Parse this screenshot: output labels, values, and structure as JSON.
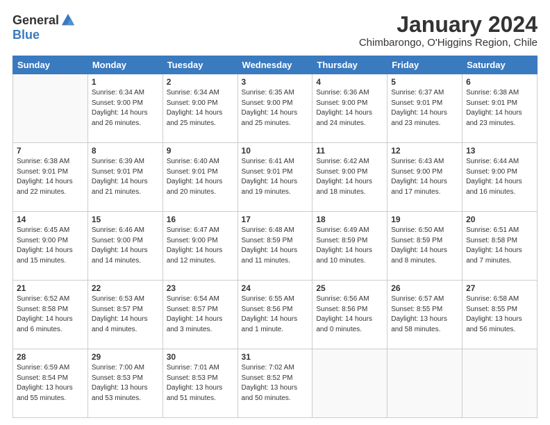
{
  "logo": {
    "general": "General",
    "blue": "Blue"
  },
  "title": "January 2024",
  "subtitle": "Chimbarongo, O'Higgins Region, Chile",
  "days_of_week": [
    "Sunday",
    "Monday",
    "Tuesday",
    "Wednesday",
    "Thursday",
    "Friday",
    "Saturday"
  ],
  "weeks": [
    [
      {
        "day": "",
        "info": ""
      },
      {
        "day": "1",
        "info": "Sunrise: 6:34 AM\nSunset: 9:00 PM\nDaylight: 14 hours\nand 26 minutes."
      },
      {
        "day": "2",
        "info": "Sunrise: 6:34 AM\nSunset: 9:00 PM\nDaylight: 14 hours\nand 25 minutes."
      },
      {
        "day": "3",
        "info": "Sunrise: 6:35 AM\nSunset: 9:00 PM\nDaylight: 14 hours\nand 25 minutes."
      },
      {
        "day": "4",
        "info": "Sunrise: 6:36 AM\nSunset: 9:00 PM\nDaylight: 14 hours\nand 24 minutes."
      },
      {
        "day": "5",
        "info": "Sunrise: 6:37 AM\nSunset: 9:01 PM\nDaylight: 14 hours\nand 23 minutes."
      },
      {
        "day": "6",
        "info": "Sunrise: 6:38 AM\nSunset: 9:01 PM\nDaylight: 14 hours\nand 23 minutes."
      }
    ],
    [
      {
        "day": "7",
        "info": "Sunrise: 6:38 AM\nSunset: 9:01 PM\nDaylight: 14 hours\nand 22 minutes."
      },
      {
        "day": "8",
        "info": "Sunrise: 6:39 AM\nSunset: 9:01 PM\nDaylight: 14 hours\nand 21 minutes."
      },
      {
        "day": "9",
        "info": "Sunrise: 6:40 AM\nSunset: 9:01 PM\nDaylight: 14 hours\nand 20 minutes."
      },
      {
        "day": "10",
        "info": "Sunrise: 6:41 AM\nSunset: 9:01 PM\nDaylight: 14 hours\nand 19 minutes."
      },
      {
        "day": "11",
        "info": "Sunrise: 6:42 AM\nSunset: 9:00 PM\nDaylight: 14 hours\nand 18 minutes."
      },
      {
        "day": "12",
        "info": "Sunrise: 6:43 AM\nSunset: 9:00 PM\nDaylight: 14 hours\nand 17 minutes."
      },
      {
        "day": "13",
        "info": "Sunrise: 6:44 AM\nSunset: 9:00 PM\nDaylight: 14 hours\nand 16 minutes."
      }
    ],
    [
      {
        "day": "14",
        "info": "Sunrise: 6:45 AM\nSunset: 9:00 PM\nDaylight: 14 hours\nand 15 minutes."
      },
      {
        "day": "15",
        "info": "Sunrise: 6:46 AM\nSunset: 9:00 PM\nDaylight: 14 hours\nand 14 minutes."
      },
      {
        "day": "16",
        "info": "Sunrise: 6:47 AM\nSunset: 9:00 PM\nDaylight: 14 hours\nand 12 minutes."
      },
      {
        "day": "17",
        "info": "Sunrise: 6:48 AM\nSunset: 8:59 PM\nDaylight: 14 hours\nand 11 minutes."
      },
      {
        "day": "18",
        "info": "Sunrise: 6:49 AM\nSunset: 8:59 PM\nDaylight: 14 hours\nand 10 minutes."
      },
      {
        "day": "19",
        "info": "Sunrise: 6:50 AM\nSunset: 8:59 PM\nDaylight: 14 hours\nand 8 minutes."
      },
      {
        "day": "20",
        "info": "Sunrise: 6:51 AM\nSunset: 8:58 PM\nDaylight: 14 hours\nand 7 minutes."
      }
    ],
    [
      {
        "day": "21",
        "info": "Sunrise: 6:52 AM\nSunset: 8:58 PM\nDaylight: 14 hours\nand 6 minutes."
      },
      {
        "day": "22",
        "info": "Sunrise: 6:53 AM\nSunset: 8:57 PM\nDaylight: 14 hours\nand 4 minutes."
      },
      {
        "day": "23",
        "info": "Sunrise: 6:54 AM\nSunset: 8:57 PM\nDaylight: 14 hours\nand 3 minutes."
      },
      {
        "day": "24",
        "info": "Sunrise: 6:55 AM\nSunset: 8:56 PM\nDaylight: 14 hours\nand 1 minute."
      },
      {
        "day": "25",
        "info": "Sunrise: 6:56 AM\nSunset: 8:56 PM\nDaylight: 14 hours\nand 0 minutes."
      },
      {
        "day": "26",
        "info": "Sunrise: 6:57 AM\nSunset: 8:55 PM\nDaylight: 13 hours\nand 58 minutes."
      },
      {
        "day": "27",
        "info": "Sunrise: 6:58 AM\nSunset: 8:55 PM\nDaylight: 13 hours\nand 56 minutes."
      }
    ],
    [
      {
        "day": "28",
        "info": "Sunrise: 6:59 AM\nSunset: 8:54 PM\nDaylight: 13 hours\nand 55 minutes."
      },
      {
        "day": "29",
        "info": "Sunrise: 7:00 AM\nSunset: 8:53 PM\nDaylight: 13 hours\nand 53 minutes."
      },
      {
        "day": "30",
        "info": "Sunrise: 7:01 AM\nSunset: 8:53 PM\nDaylight: 13 hours\nand 51 minutes."
      },
      {
        "day": "31",
        "info": "Sunrise: 7:02 AM\nSunset: 8:52 PM\nDaylight: 13 hours\nand 50 minutes."
      },
      {
        "day": "",
        "info": ""
      },
      {
        "day": "",
        "info": ""
      },
      {
        "day": "",
        "info": ""
      }
    ]
  ]
}
